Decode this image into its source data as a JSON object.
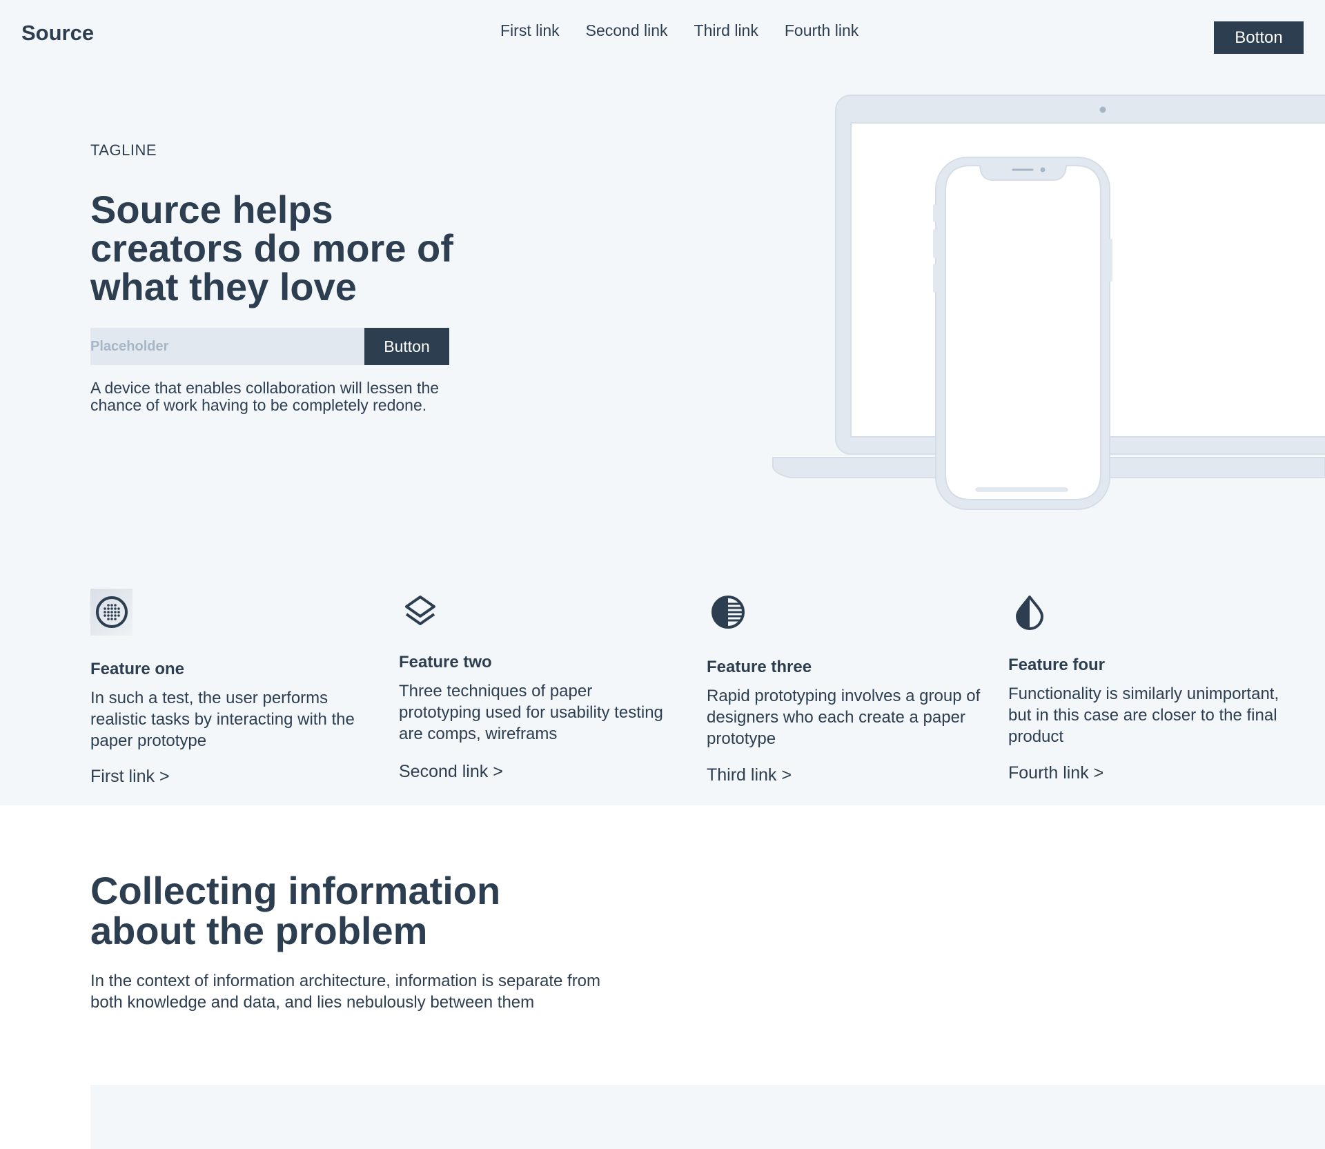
{
  "header": {
    "logo": "Source",
    "nav_links": [
      "First link",
      "Second link",
      "Third link",
      "Fourth link"
    ],
    "button_label": "Botton"
  },
  "hero": {
    "tagline": "TAGLINE",
    "title": "Source helps creators do more of what they love",
    "input_placeholder": "Placeholder",
    "button_label": "Button",
    "description": "A device that enables collaboration will lessen the chance of work having to be completely redone."
  },
  "illustration": {
    "icons": [
      "laptop-illustration",
      "phone-illustration"
    ]
  },
  "features": [
    {
      "icon": "globe-grid-icon",
      "title": "Feature one",
      "text": "In such a test, the user performs realistic tasks by interacting with the paper prototype",
      "link": "First link >"
    },
    {
      "icon": "layers-icon",
      "title": "Feature two",
      "text": "Three techniques of paper prototyping used for usability testing are comps, wireframs",
      "link": "Second link >"
    },
    {
      "icon": "contrast-icon",
      "title": "Feature three",
      "text": "Rapid prototyping involves a group of designers who each create a paper prototype",
      "link": "Third link >"
    },
    {
      "icon": "drop-icon",
      "title": "Feature four",
      "text": "Functionality is similarly unimportant, but in this case are closer to the final product",
      "link": "Fourth link >"
    }
  ],
  "section_two": {
    "title": "Collecting information about the problem",
    "description": "In the context of information architecture, information is separate from both knowledge and data, and lies nebulously between them"
  },
  "colors": {
    "primary": "#2c3e50",
    "light_bg": "#f4f7fa",
    "input_bg": "#e2e8ef",
    "device_gray": "#e2e8ef"
  }
}
